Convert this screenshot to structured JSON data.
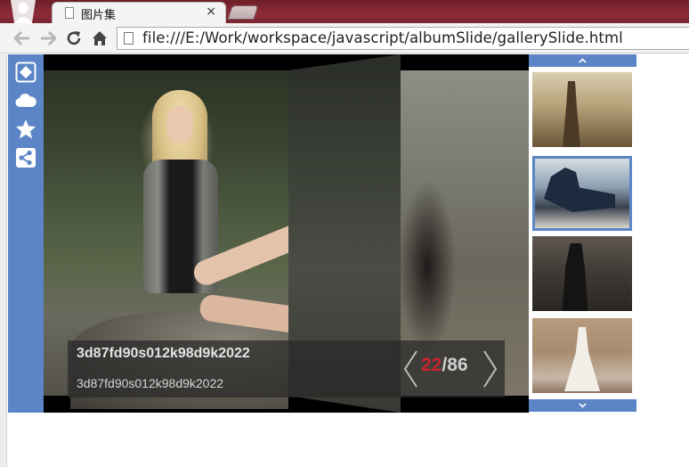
{
  "browser": {
    "tab_title": "图片集",
    "tab_close": "×",
    "url": "file:///E:/Work/workspace/javascript/albumSlide/gallerySlide.html"
  },
  "sidebar": {
    "icons": [
      "fullscreen-icon",
      "cloud-icon",
      "star-icon",
      "share-icon"
    ]
  },
  "slide": {
    "title": "3d87fd90s012k98d9k2022",
    "description": "3d87fd90s012k98d9k2022",
    "current": "22",
    "separator": "/",
    "total": "86"
  },
  "thumbnails": {
    "count": 4,
    "active_index": 1
  },
  "colors": {
    "accent": "#5b85c6",
    "current_index": "#c8242c",
    "titlebar": "#7a2430"
  }
}
